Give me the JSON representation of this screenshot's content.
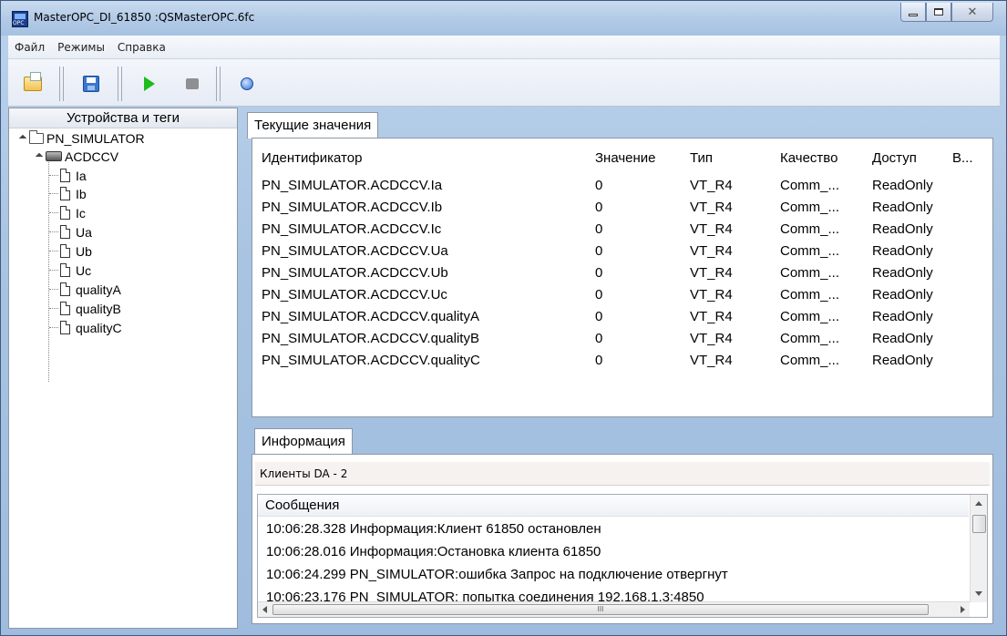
{
  "window": {
    "title": "MasterOPC_DI_61850 :QSMasterOPC.6fc"
  },
  "menu": [
    "Файл",
    "Режимы",
    "Справка"
  ],
  "toolbar": {
    "icons": [
      "open-icon",
      "save-icon",
      "play-icon",
      "stop-icon",
      "help-icon"
    ],
    "colors": {
      "play": "#1dbb1d",
      "stop": "#8d8f93"
    }
  },
  "tree": {
    "header": "Устройства и теги",
    "root": "PN_SIMULATOR",
    "device": "ACDCCV",
    "tags": [
      "Ia",
      "Ib",
      "Ic",
      "Ua",
      "Ub",
      "Uc",
      "qualityA",
      "qualityB",
      "qualityC"
    ]
  },
  "values": {
    "tab": "Текущие значения",
    "columns": [
      "Идентификатор",
      "Значение",
      "Тип",
      "Качество",
      "Доступ",
      "В..."
    ],
    "rows": [
      [
        "PN_SIMULATOR.ACDCCV.Ia",
        "0",
        "VT_R4",
        "Comm_...",
        "ReadOnly"
      ],
      [
        "PN_SIMULATOR.ACDCCV.Ib",
        "0",
        "VT_R4",
        "Comm_...",
        "ReadOnly"
      ],
      [
        "PN_SIMULATOR.ACDCCV.Ic",
        "0",
        "VT_R4",
        "Comm_...",
        "ReadOnly"
      ],
      [
        "PN_SIMULATOR.ACDCCV.Ua",
        "0",
        "VT_R4",
        "Comm_...",
        "ReadOnly"
      ],
      [
        "PN_SIMULATOR.ACDCCV.Ub",
        "0",
        "VT_R4",
        "Comm_...",
        "ReadOnly"
      ],
      [
        "PN_SIMULATOR.ACDCCV.Uc",
        "0",
        "VT_R4",
        "Comm_...",
        "ReadOnly"
      ],
      [
        "PN_SIMULATOR.ACDCCV.qualityA",
        "0",
        "VT_R4",
        "Comm_...",
        "ReadOnly"
      ],
      [
        "PN_SIMULATOR.ACDCCV.qualityB",
        "0",
        "VT_R4",
        "Comm_...",
        "ReadOnly"
      ],
      [
        "PN_SIMULATOR.ACDCCV.qualityC",
        "0",
        "VT_R4",
        "Comm_...",
        "ReadOnly"
      ]
    ]
  },
  "info": {
    "tab": "Информация",
    "clients": "Клиенты DA - 2",
    "messages_header": "Сообщения",
    "messages": [
      "10:06:28.328 Информация:Клиент 61850 остановлен",
      "10:06:28.016 Информация:Остановка клиента 61850",
      "10:06:24.299 PN_SIMULATOR:ошибка Запрос на подключение отвергнут",
      "10:06:23.176 PN_SIMULATOR: попытка соединения 192.168.1.3:4850"
    ],
    "scroll_grip": "III"
  }
}
